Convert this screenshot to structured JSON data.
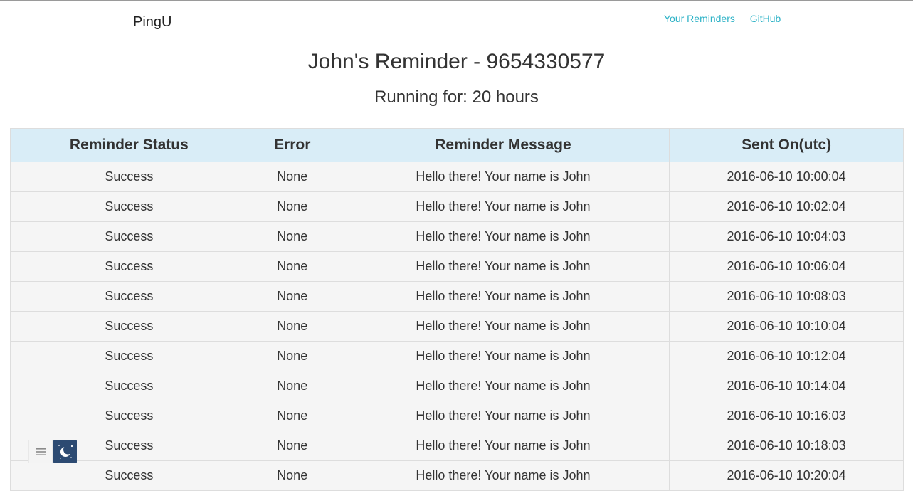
{
  "navbar": {
    "brand": "PingU",
    "links": [
      {
        "label": "Your Reminders"
      },
      {
        "label": "GitHub"
      }
    ]
  },
  "page": {
    "title": "John's Reminder - 9654330577",
    "subtitle": "Running for: 20 hours"
  },
  "table": {
    "headers": [
      "Reminder Status",
      "Error",
      "Reminder Message",
      "Sent On(utc)"
    ],
    "rows": [
      [
        "Success",
        "None",
        "Hello there! Your name is John",
        "2016-06-10 10:00:04"
      ],
      [
        "Success",
        "None",
        "Hello there! Your name is John",
        "2016-06-10 10:02:04"
      ],
      [
        "Success",
        "None",
        "Hello there! Your name is John",
        "2016-06-10 10:04:03"
      ],
      [
        "Success",
        "None",
        "Hello there! Your name is John",
        "2016-06-10 10:06:04"
      ],
      [
        "Success",
        "None",
        "Hello there! Your name is John",
        "2016-06-10 10:08:03"
      ],
      [
        "Success",
        "None",
        "Hello there! Your name is John",
        "2016-06-10 10:10:04"
      ],
      [
        "Success",
        "None",
        "Hello there! Your name is John",
        "2016-06-10 10:12:04"
      ],
      [
        "Success",
        "None",
        "Hello there! Your name is John",
        "2016-06-10 10:14:04"
      ],
      [
        "Success",
        "None",
        "Hello there! Your name is John",
        "2016-06-10 10:16:03"
      ],
      [
        "Success",
        "None",
        "Hello there! Your name is John",
        "2016-06-10 10:18:03"
      ],
      [
        "Success",
        "None",
        "Hello there! Your name is John",
        "2016-06-10 10:20:04"
      ]
    ]
  },
  "widget": {
    "menu_icon": "hamburger-menu-icon",
    "moon_icon": "moon-night-mode-icon"
  },
  "colors": {
    "link": "#2fb3c7",
    "header_bg": "#d9edf7",
    "row_bg": "#f5f5f5",
    "moon_bg": "#2c4a72"
  }
}
